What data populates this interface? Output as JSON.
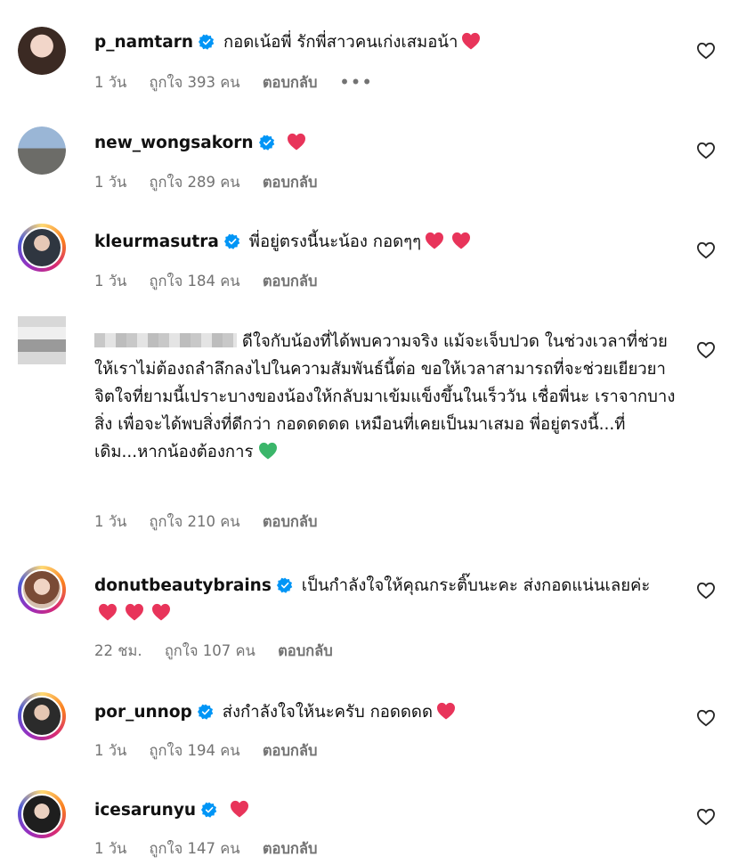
{
  "comments": [
    {
      "username": "p_namtarn",
      "text": "กอดเน้อพี่ รักพี่สาวคนเก่งเสมอน้า",
      "time": "1 วัน",
      "likes": "ถูกใจ 393 คน",
      "reply": "ตอบกลับ",
      "more": "•••"
    },
    {
      "username": "new_wongsakorn",
      "text": "",
      "time": "1 วัน",
      "likes": "ถูกใจ 289 คน",
      "reply": "ตอบกลับ"
    },
    {
      "username": "kleurmasutra",
      "text": "พี่อยู่ตรงนี้นะน้อง กอดๆๆ",
      "time": "1 วัน",
      "likes": "ถูกใจ 184 คน",
      "reply": "ตอบกลับ"
    },
    {
      "username": "",
      "text": "ดีใจกับน้องที่ได้พบความจริง แม้จะเจ็บปวด ในช่วงเวลาที่ช่วยให้เราไม่ต้องถลำลึกลงไปในความสัมพันธ์นี้ต่อ ขอให้เวลาสามารถที่จะช่วยเยียวยาจิตใจที่ยามนี้เปราะบางของน้องให้กลับมาเข้มแข็งขึ้นในเร็ววัน เชื่อพี่นะ เราจากบางสิ่ง เพื่อจะได้พบสิ่งที่ดีกว่า กอดดดดด เหมือนที่เคยเป็นมาเสมอ พี่อยู่ตรงนี้...ที่เดิม...หากน้องต้องการ",
      "time": "1 วัน",
      "likes": "ถูกใจ 210 คน",
      "reply": "ตอบกลับ"
    },
    {
      "username": "donutbeautybrains",
      "text": "เป็นกำลังใจให้คุณกระติ๊บนะคะ ส่งกอดแน่นเลยค่ะ",
      "time": "22 ชม.",
      "likes": "ถูกใจ 107 คน",
      "reply": "ตอบกลับ"
    },
    {
      "username": "por_unnop",
      "text": "ส่งกำลังใจให้นะครับ กอดดดด",
      "time": "1 วัน",
      "likes": "ถูกใจ 194 คน",
      "reply": "ตอบกลับ"
    },
    {
      "username": "icesarunyu",
      "text": "",
      "time": "1 วัน",
      "likes": "ถูกใจ 147 คน",
      "reply": "ตอบกลับ"
    }
  ],
  "colors": {
    "verified": "#0095f6",
    "heart": "#e8345a",
    "green_heart": "#3bb66a",
    "meta": "#737373"
  },
  "icons": {
    "verified": "verified-badge-icon",
    "like": "heart-outline-icon",
    "emoji_heart": "red-heart-emoji",
    "emoji_green": "green-heart-emoji"
  }
}
